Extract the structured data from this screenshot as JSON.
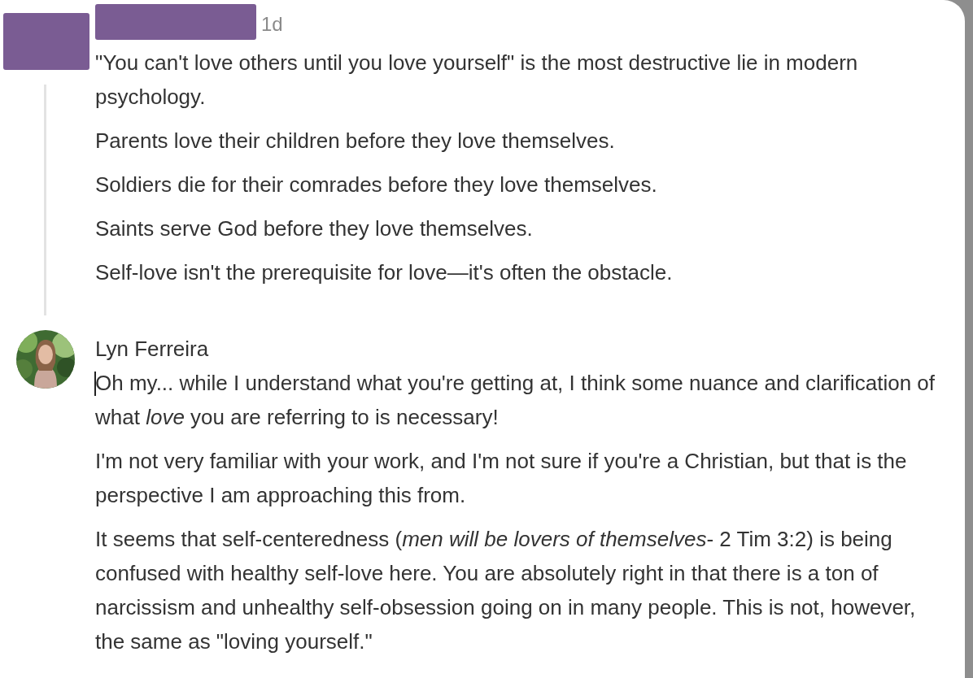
{
  "comments": [
    {
      "author_hidden": true,
      "time": "1d",
      "caret": false,
      "paragraphs": [
        "\"You can't love others until you love yourself\" is the most destructive lie in modern psychology.",
        "Parents love their children before they love themselves.",
        "Soldiers die for their comrades before they love themselves.",
        "Saints serve God before they love themselves.",
        "Self-love isn't the prerequisite for love—it's often the obstacle."
      ]
    },
    {
      "author_hidden": false,
      "author": "Lyn Ferreira",
      "caret": true,
      "paragraphs": [
        "Oh my... while I understand what you're getting at, I think some nuance and clarification of what *love* you are referring to is necessary!",
        "I'm not very familiar with your work, and I'm not sure if you're a Christian, but that is the perspective I am approaching this from.",
        "It seems that self-centeredness (*men will be lovers of themselves*- 2 Tim 3:2) is being confused with healthy self-love here. You are absolutely right in that there is a ton of narcissism and unhealthy self-obsession going on in many people. This is not, however, the same as \"loving yourself.\""
      ]
    }
  ]
}
